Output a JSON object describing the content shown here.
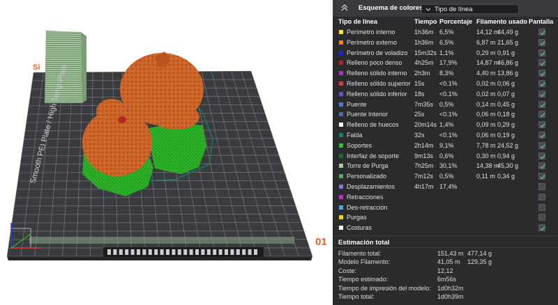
{
  "viewport": {
    "plate_label": "Smooth PEI Plate / High Temp Plate",
    "plate_number": "01",
    "top_left_partial_text": "Si"
  },
  "legend": {
    "title": "Esquema de colores",
    "selected_scheme": "Tipo de línea",
    "headers": {
      "type": "Tipo de línea",
      "time": "Tiempo",
      "percent": "Porcentaje",
      "filament": "Filamento usado",
      "display": "Pantalla"
    },
    "rows": [
      {
        "name": "Perímetro interno",
        "time": "1h36m",
        "percent": "6,5%",
        "length": "14,12 m",
        "weight": "44,49 g",
        "color": "#f5e33b",
        "checked": true
      },
      {
        "name": "Perímetro externo",
        "time": "1h36m",
        "percent": "6,5%",
        "length": "6,87 m",
        "weight": "21,65 g",
        "color": "#f07f30",
        "checked": true
      },
      {
        "name": "Perímetro de voladizo",
        "time": "15m32s",
        "percent": "1,1%",
        "length": "0,29 m",
        "weight": "0,91 g",
        "color": "#2424d6",
        "checked": true
      },
      {
        "name": "Relleno poco denso",
        "time": "4h25m",
        "percent": "17,9%",
        "length": "14,87 m",
        "weight": "46,86 g",
        "color": "#a8282c",
        "checked": true
      },
      {
        "name": "Relleno sólido interno",
        "time": "2h3m",
        "percent": "8,3%",
        "length": "4,40 m",
        "weight": "13,86 g",
        "color": "#9c3ab8",
        "checked": true
      },
      {
        "name": "Relleno sólido superior",
        "time": "15s",
        "percent": "<0.1%",
        "length": "0,02 m",
        "weight": "0,06 g",
        "color": "#d23c32",
        "checked": true
      },
      {
        "name": "Relleno sólido inferior",
        "time": "18s",
        "percent": "<0.1%",
        "length": "0,02 m",
        "weight": "0,07 g",
        "color": "#7050c0",
        "checked": true
      },
      {
        "name": "Puente",
        "time": "7m35s",
        "percent": "0,5%",
        "length": "0,14 m",
        "weight": "0,45 g",
        "color": "#5080c0",
        "checked": true
      },
      {
        "name": "Puente Interior",
        "time": "25s",
        "percent": "<0.1%",
        "length": "0,06 m",
        "weight": "0,18 g",
        "color": "#4a6aa8",
        "checked": true
      },
      {
        "name": "Relleno de huecos",
        "time": "20m14s",
        "percent": "1,4%",
        "length": "0,09 m",
        "weight": "0,29 g",
        "color": "#ffffff",
        "checked": true
      },
      {
        "name": "Falda",
        "time": "32s",
        "percent": "<0.1%",
        "length": "0,06 m",
        "weight": "0,19 g",
        "color": "#1e7a6a",
        "checked": true
      },
      {
        "name": "Soportes",
        "time": "2h14m",
        "percent": "9,1%",
        "length": "7,78 m",
        "weight": "24,52 g",
        "color": "#30c030",
        "checked": true
      },
      {
        "name": "Interfaz de soporte",
        "time": "9m13s",
        "percent": "0,6%",
        "length": "0,30 m",
        "weight": "0,94 g",
        "color": "#206a30",
        "checked": true
      },
      {
        "name": "Torre de Purga",
        "time": "7h25m",
        "percent": "30,1%",
        "length": "14,38 m",
        "weight": "45,30 g",
        "color": "#a8c8a0",
        "checked": true
      },
      {
        "name": "Personalizado",
        "time": "7m12s",
        "percent": "0,5%",
        "length": "0,11 m",
        "weight": "0,34 g",
        "color": "#4aa86a",
        "checked": true
      },
      {
        "name": "Desplazamientos",
        "time": "4h17m",
        "percent": "17,4%",
        "length": "",
        "weight": "",
        "color": "#7a7ad8",
        "checked": false
      },
      {
        "name": "Retracciones",
        "time": "",
        "percent": "",
        "length": "",
        "weight": "",
        "color": "#c030c0",
        "checked": false
      },
      {
        "name": "Des-retracción",
        "time": "",
        "percent": "",
        "length": "",
        "weight": "",
        "color": "#4aa8d8",
        "checked": false
      },
      {
        "name": "Purgas",
        "time": "",
        "percent": "",
        "length": "",
        "weight": "",
        "color": "#e8d820",
        "checked": false
      },
      {
        "name": "Costuras",
        "time": "",
        "percent": "",
        "length": "",
        "weight": "",
        "color": "#f0f0f0",
        "checked": true
      }
    ]
  },
  "estimate": {
    "title": "Estimación total",
    "rows": [
      {
        "label": "Filamento total:",
        "v1": "151,43 m",
        "v2": "477,14 g"
      },
      {
        "label": "Modelo Filamento:",
        "v1": "41,05 m",
        "v2": "129,35 g"
      },
      {
        "label": "Coste:",
        "v1": "12,12",
        "v2": ""
      },
      {
        "label": "Tiempo estimado:",
        "v1": "6m56s",
        "v2": ""
      },
      {
        "label": "Tiempo de impresión del modelo:",
        "v1": "1d0h32m",
        "v2": ""
      },
      {
        "label": "Tiempo total:",
        "v1": "1d0h39m",
        "v2": ""
      }
    ]
  }
}
